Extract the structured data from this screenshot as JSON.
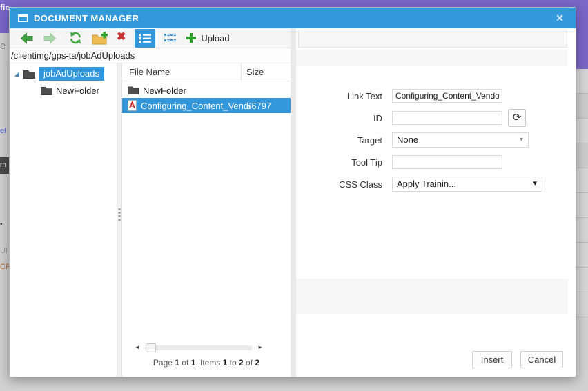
{
  "background": {
    "fragments": {
      "top_left": "fic",
      "letter": "e",
      "link": "el",
      "button": "rn",
      "printer": "▪",
      "ui": "UI",
      "cri": "CRI"
    }
  },
  "dialog": {
    "title": "DOCUMENT MANAGER"
  },
  "icons": {
    "close": "✕",
    "delete": "✖",
    "scroll_left": "◄",
    "scroll_right": "►",
    "caret_down": "▾",
    "refresh_input": "⟳"
  },
  "toolbar": {
    "upload_label": "Upload"
  },
  "address": {
    "path": "/clientimg/gps-ta/jobAdUploads"
  },
  "tree": {
    "items": [
      {
        "label": "jobAdUploads"
      },
      {
        "label": "NewFolder"
      }
    ]
  },
  "files": {
    "columns": {
      "name": "File Name",
      "size": "Size"
    },
    "rows": [
      {
        "name": "NewFolder",
        "size": ""
      },
      {
        "name": "Configuring_Content_Vendo",
        "size": "66797"
      }
    ],
    "pagination": {
      "w1": "Page ",
      "n1": "1",
      "w2": " of ",
      "n2": "1",
      "w3": ". Items ",
      "n3": "1",
      "w4": " to ",
      "n4": "2",
      "w5": " of ",
      "n5": "2"
    }
  },
  "form": {
    "fields": [
      {
        "label": "Link Text",
        "value": "Configuring_Content_Vendor"
      },
      {
        "label": "ID",
        "value": ""
      },
      {
        "label": "Target",
        "value": "None"
      },
      {
        "label": "Tool Tip",
        "value": ""
      },
      {
        "label": "CSS Class",
        "value": "Apply Trainin..."
      }
    ]
  },
  "footer": {
    "insert_label": "Insert",
    "cancel_label": "Cancel"
  },
  "colors": {
    "accent": "#3398db",
    "purple": "#7a68c8",
    "toolbar_green": "#3fa13f",
    "delete_red": "#c53030"
  }
}
